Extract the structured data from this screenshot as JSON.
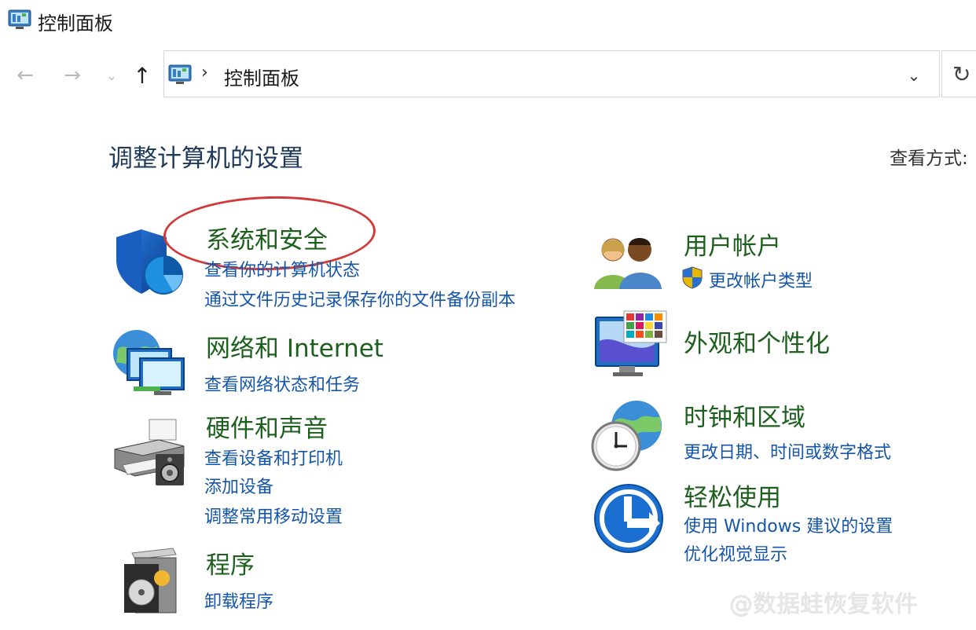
{
  "window": {
    "title": "控制面板"
  },
  "nav": {
    "back_icon": "←",
    "forward_icon": "→",
    "recent_icon": "⌄",
    "up_icon": "↑",
    "breadcrumb_sep": "›",
    "breadcrumb": "控制面板",
    "dropdown_icon": "⌄",
    "refresh_icon": "↻"
  },
  "header": {
    "title": "调整计算机的设置",
    "view_by_label": "查看方式:"
  },
  "categories": {
    "system_security": {
      "title": "系统和安全",
      "links": [
        "查看你的计算机状态",
        "通过文件历史记录保存你的文件备份副本"
      ],
      "icon": "shield-icon"
    },
    "network": {
      "title": "网络和 Internet",
      "links": [
        "查看网络状态和任务"
      ],
      "icon": "network-icon"
    },
    "hardware": {
      "title": "硬件和声音",
      "links": [
        "查看设备和打印机",
        "添加设备",
        "调整常用移动设置"
      ],
      "icon": "printer-icon"
    },
    "programs": {
      "title": "程序",
      "links": [
        "卸载程序"
      ],
      "icon": "programs-icon"
    },
    "user_accounts": {
      "title": "用户帐户",
      "links": [
        "更改帐户类型"
      ],
      "icon": "users-icon"
    },
    "appearance": {
      "title": "外观和个性化",
      "links": [],
      "icon": "appearance-icon"
    },
    "clock_region": {
      "title": "时钟和区域",
      "links": [
        "更改日期、时间或数字格式"
      ],
      "icon": "clock-globe-icon"
    },
    "ease_access": {
      "title": "轻松使用",
      "links": [
        "使用 Windows 建议的设置",
        "优化视觉显示"
      ],
      "icon": "ease-of-access-icon"
    }
  },
  "watermark": {
    "text": "@数据蛙恢复软件"
  },
  "colors": {
    "category_title": "#1d5f1d",
    "link": "#1556a8",
    "heading": "#1e3a5a",
    "annotation": "#d23a3a"
  }
}
